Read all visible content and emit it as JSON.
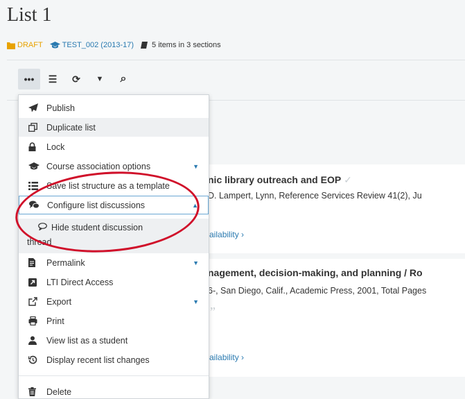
{
  "header": {
    "title": "List 1",
    "status": "DRAFT",
    "course": "TEST_002 (2013-17)",
    "items_summary": "5 items in 3 sections"
  },
  "toolbar": {
    "buttons": [
      {
        "name": "more-options",
        "glyph": "•••"
      },
      {
        "name": "list-view",
        "glyph": "☰"
      },
      {
        "name": "refresh",
        "glyph": "⟳"
      },
      {
        "name": "filter",
        "glyph": "▼"
      },
      {
        "name": "search",
        "glyph": "⌕"
      }
    ]
  },
  "menu": {
    "items": [
      {
        "label": "Publish",
        "icon": "paper-plane-icon"
      },
      {
        "label": "Duplicate list",
        "icon": "duplicate-icon"
      },
      {
        "label": "Lock",
        "icon": "lock-icon"
      },
      {
        "label": "Course association options",
        "icon": "graduation-cap-icon"
      },
      {
        "label": "Save list structure as a template",
        "icon": "list-icon"
      },
      {
        "label": "Configure list discussions",
        "icon": "comments-icon"
      },
      {
        "label": "Permalink",
        "icon": "permalink-icon"
      },
      {
        "label": "LTI Direct Access",
        "icon": "lti-icon"
      },
      {
        "label": "Export",
        "icon": "export-icon"
      },
      {
        "label": "Print",
        "icon": "print-icon"
      },
      {
        "label": "View list as a student",
        "icon": "user-icon"
      },
      {
        "label": "Display recent list changes",
        "icon": "history-icon"
      },
      {
        "label": "Delete",
        "icon": "trash-icon"
      }
    ],
    "submenu": {
      "label_line1": "Hide student discussion",
      "label_line2": "thread"
    }
  },
  "content": {
    "cards": [
      {
        "title": "nic library outreach and EOP",
        "line": "D. Lampert, Lynn, Reference Services Review 41(2), Ju",
        "availability": "k availability ›"
      },
      {
        "title": "nagement, decision-making, and planning / Ro",
        "line": "6-, San Diego, Calif., Academic Press, 2001, Total Pages",
        "availability": "k availability ›"
      }
    ]
  },
  "colors": {
    "draft": "#e8a200",
    "link": "#2a7ab0",
    "highlight_ring": "#d0102a"
  }
}
